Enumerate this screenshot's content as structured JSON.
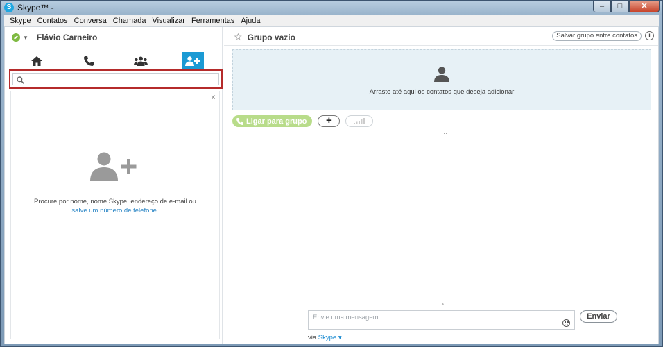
{
  "window": {
    "title": "Skype™ -",
    "minimize": "–",
    "maximize": "□",
    "close": "✕"
  },
  "menu": [
    "Skype",
    "Contatos",
    "Conversa",
    "Chamada",
    "Visualizar",
    "Ferramentas",
    "Ajuda"
  ],
  "profile": {
    "name": "Flávio Carneiro",
    "status_color": "#7fba42"
  },
  "nav_tabs": [
    "home-icon",
    "phone-icon",
    "contacts-group-icon",
    "add-contact-icon"
  ],
  "search": {
    "value": "",
    "placeholder": ""
  },
  "results": {
    "close": "×",
    "hint_line1": "Procure por nome, nome Skype, endereço de e-mail ou",
    "hint_link": "salve um número de telefone."
  },
  "group": {
    "title": "Grupo vazio",
    "save_button": "Salvar grupo entre contatos",
    "info": "i",
    "dropzone_text": "Arraste até aqui os contatos que deseja adicionar",
    "call_button": "Ligar para grupo",
    "plus": "+"
  },
  "compose": {
    "placeholder": "Envie uma mensagem",
    "send": "Enviar",
    "via_prefix": "via",
    "via_service": "Skype"
  },
  "colors": {
    "accent": "#1b9ad4",
    "highlight_border": "#b52b2b",
    "call_green": "#b8dc8a",
    "dropzone_bg": "#e7f1f6"
  }
}
